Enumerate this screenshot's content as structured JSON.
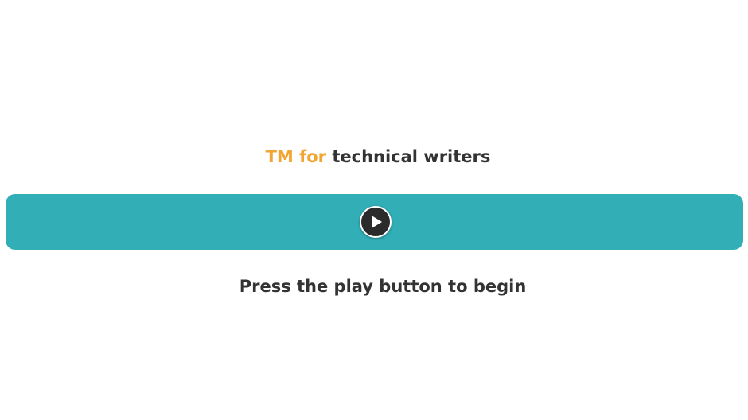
{
  "title": {
    "accent_text": "TM for",
    "main_text": "technical writers"
  },
  "player": {
    "play_icon": "play-icon",
    "bar_color": "#32AEB7"
  },
  "instruction": {
    "text": "Press the play button to begin"
  },
  "colors": {
    "accent": "#F2A533",
    "text": "#333333"
  }
}
